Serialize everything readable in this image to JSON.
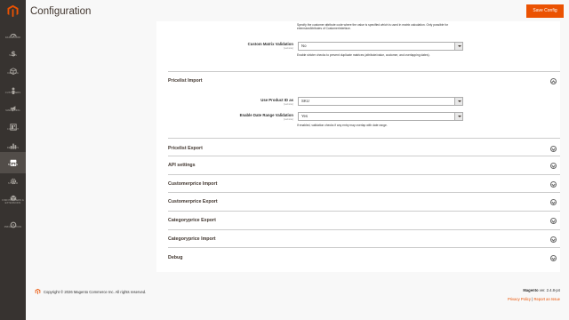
{
  "header": {
    "title": "Configuration",
    "save_label": "Save Config"
  },
  "sidebar": {
    "items": [
      {
        "label": "DASHBOARD",
        "icon": "dashboard-icon"
      },
      {
        "label": "SALES",
        "icon": "dollar-icon"
      },
      {
        "label": "CATALOG",
        "icon": "cube-icon"
      },
      {
        "label": "CUSTOMERS",
        "icon": "person-icon"
      },
      {
        "label": "MARKETING",
        "icon": "megaphone-icon"
      },
      {
        "label": "CONTENT",
        "icon": "layout-icon"
      },
      {
        "label": "REPORTS",
        "icon": "bar-chart-icon"
      },
      {
        "label": "STORES",
        "icon": "store-icon"
      },
      {
        "label": "SYSTEM",
        "icon": "gear-icon"
      },
      {
        "label": "FIND PARTNERS & EXTENSIONS",
        "icon": "puzzle-icon"
      },
      {
        "label": "PRICEVISTION",
        "icon": "circle-icon"
      }
    ],
    "active_index": 7
  },
  "top_fields": {
    "note1": "Specify the customer attribute code where the value is specified which is used in matrix calculation. Only possible for extensionAttributes of CustomerInterface.",
    "custom_matrix": {
      "label": "Custom Matrix Validation",
      "scope": "[website]",
      "value": "No",
      "note": "Enable stricter checks to prevent duplicate matrices (attribute/value, customer, and overlapping dates)."
    }
  },
  "pricelist_import": {
    "title": "Pricelist Import",
    "use_product_id": {
      "label": "Use Product ID as",
      "scope": "[website]",
      "value": "SKU"
    },
    "enable_date_range": {
      "label": "Enable Date Range Validation",
      "scope": "[website]",
      "value": "Yes",
      "note": "If enabled, validation checks if any entry may overlap with date range."
    }
  },
  "sections": [
    {
      "title": "Pricelist Export"
    },
    {
      "title": "API settings"
    },
    {
      "title": "Customerprice Import"
    },
    {
      "title": "Customerprice Export"
    },
    {
      "title": "Categoryprice Export"
    },
    {
      "title": "Categoryprice Import"
    },
    {
      "title": "Debug"
    }
  ],
  "footer": {
    "copyright": "Copyright © 2026 Magento Commerce Inc. All rights reserved.",
    "brand": "Magento",
    "version": "ver. 2.4.8-p4",
    "privacy": "Privacy Policy",
    "separator": "|",
    "report": "Report an Issue"
  },
  "colors": {
    "accent": "#eb5202",
    "sidebar": "#373330",
    "active": "#524d49"
  }
}
